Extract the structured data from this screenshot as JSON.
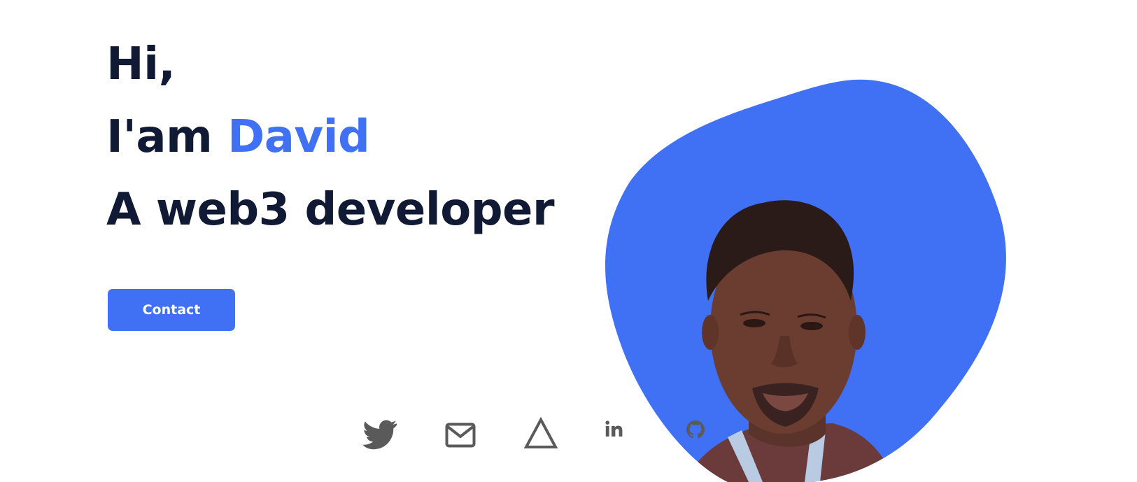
{
  "hero": {
    "greeting": "Hi,",
    "intro_prefix": "I'am ",
    "name": "David",
    "role": "A web3 developer",
    "contact_label": "Contact"
  },
  "socials": [
    {
      "icon": "twitter-icon"
    },
    {
      "icon": "mail-icon"
    },
    {
      "icon": "triangle-icon"
    },
    {
      "icon": "linkedin-icon"
    },
    {
      "icon": "github-icon"
    }
  ],
  "colors": {
    "accent": "#4070f4",
    "heading": "#111a35",
    "icon": "#5a5a5a",
    "background": "#ffffff"
  }
}
